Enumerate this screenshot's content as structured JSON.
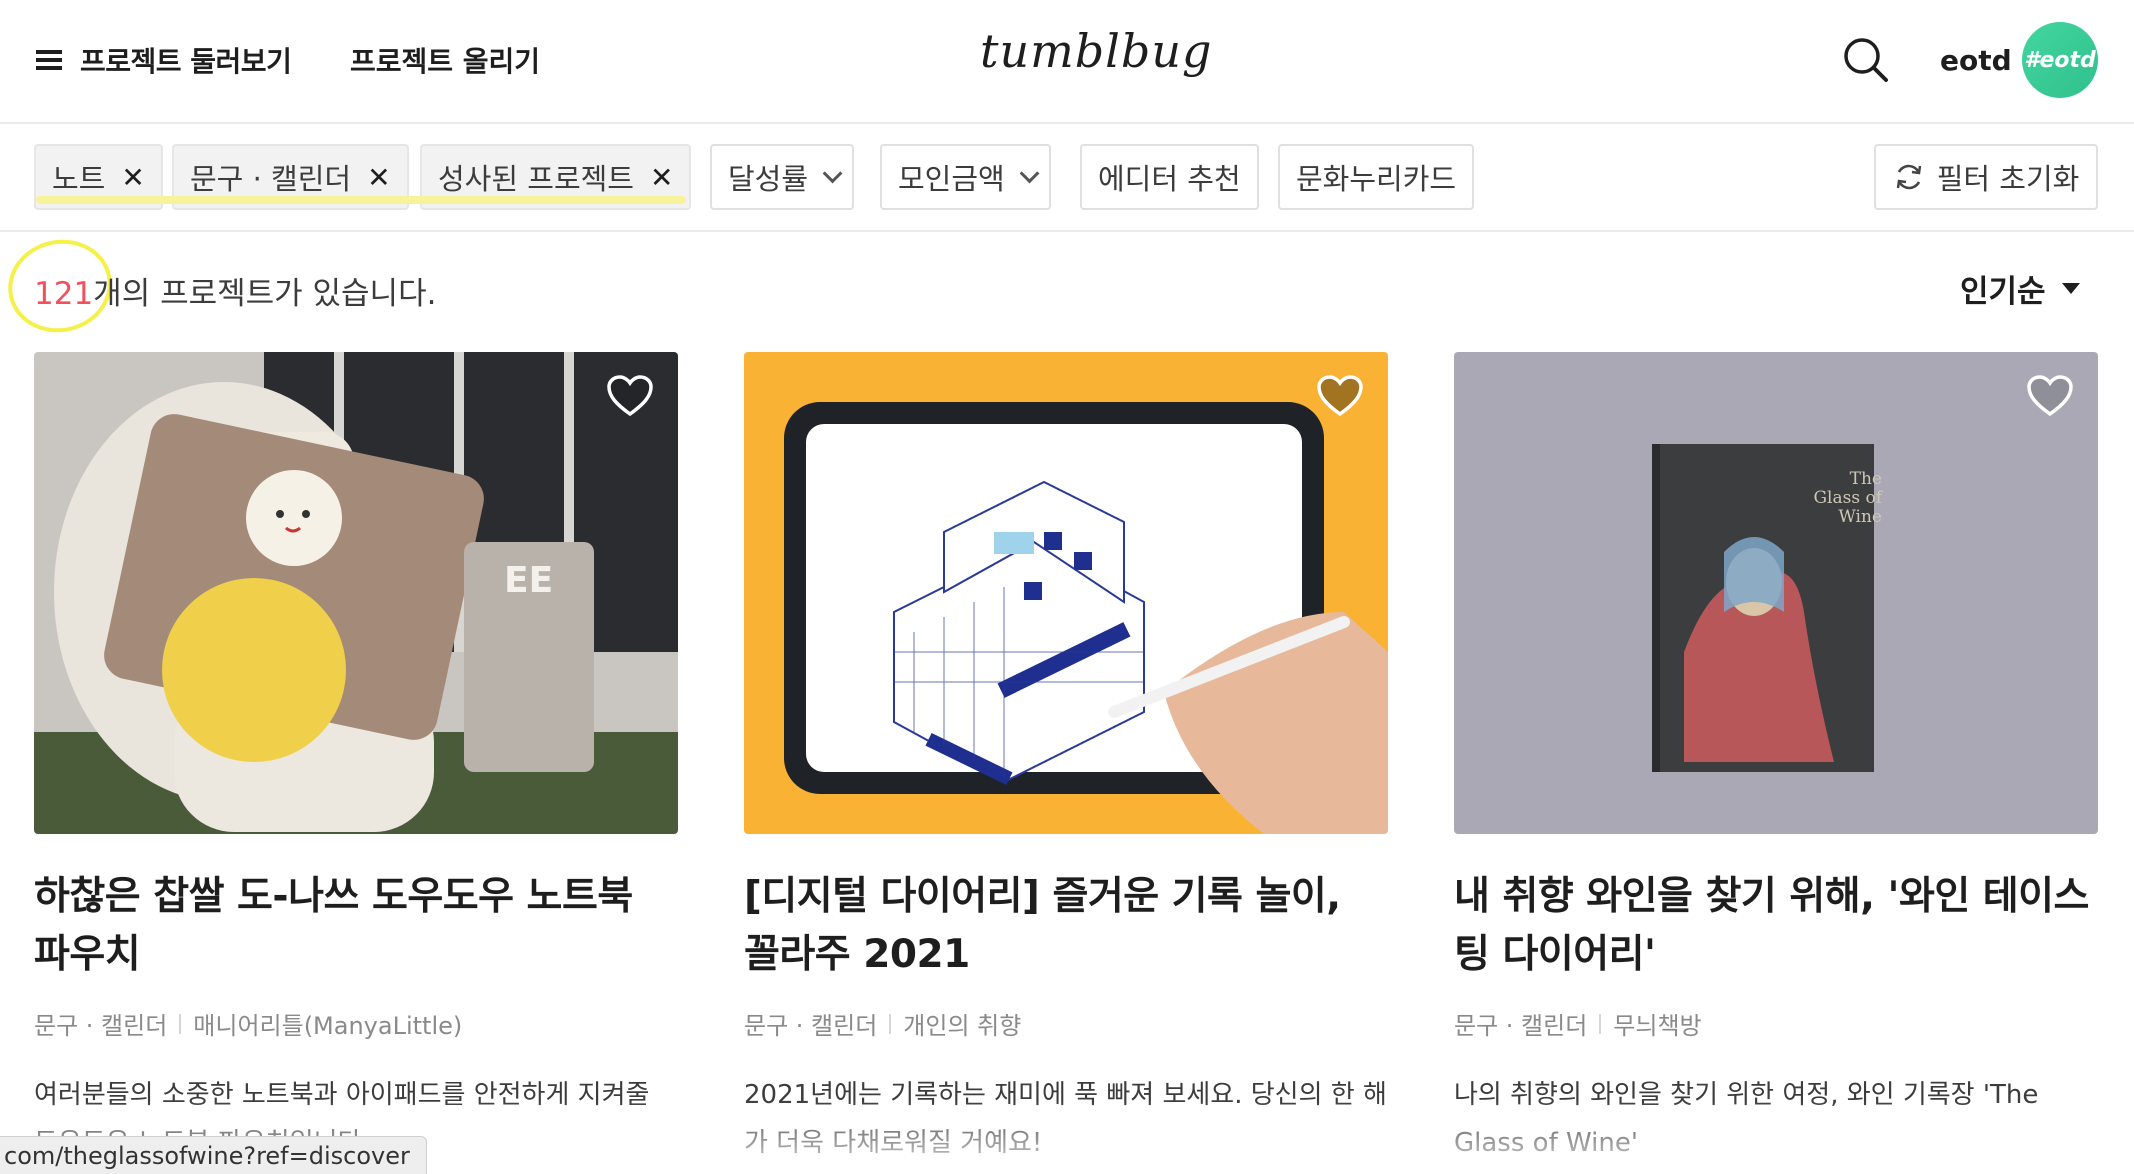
{
  "header": {
    "menu_label": "프로젝트 둘러보기",
    "upload_label": "프로젝트 올리기",
    "logo": "tumblbug",
    "user_name": "eotd",
    "avatar_text": "#eotd"
  },
  "filters": {
    "chips": [
      {
        "label": "노트",
        "removable": true
      },
      {
        "label": "문구 · 캘린더",
        "removable": true
      },
      {
        "label": "성사된 프로젝트",
        "removable": true
      },
      {
        "label": "달성률",
        "dropdown": true
      },
      {
        "label": "모인금액",
        "dropdown": true
      },
      {
        "label": "에디터 추천"
      },
      {
        "label": "문화누리카드"
      }
    ],
    "reset_label": "필터 초기화"
  },
  "results": {
    "count": "121",
    "count_suffix": "개의 프로젝트가 있습니다.",
    "sort_label": "인기순"
  },
  "cards": [
    {
      "title": "하찮은 찹쌀 도-나쓰 도우도우 노트북 파우치",
      "category": "문구 · 캘린더",
      "creator": "매니어리틀(ManyaLittle)",
      "description": "여러분들의 소중한 노트북과 아이패드를 안전하게 지켜줄 도우도우 노트북 파우치입니다."
    },
    {
      "title": "[디지털 다이어리] 즐거운 기록 놀이, 꼴라주 2021",
      "category": "문구 · 캘린더",
      "creator": "개인의 취향",
      "description": "2021년에는 기록하는 재미에 푹 빠져 보세요. 당신의 한 해가 더욱 다채로워질 거예요!"
    },
    {
      "title": "내 취향 와인을 찾기 위해, '와인 테이스팅 다이어리'",
      "category": "문구 · 캘린더",
      "creator": "무늬책방",
      "description": "나의 취향의 와인을 찾기 위한 여정, 와인 기록장 'The Glass of Wine'",
      "book_text": "The Glass of Wine"
    }
  ],
  "status_url": "com/theglassofwine?ref=discover",
  "colors": {
    "accent_red": "#f1505c",
    "highlight_yellow": "#f7f39a",
    "avatar_green": "#44d6a0",
    "card2_bg": "#f9b233"
  }
}
